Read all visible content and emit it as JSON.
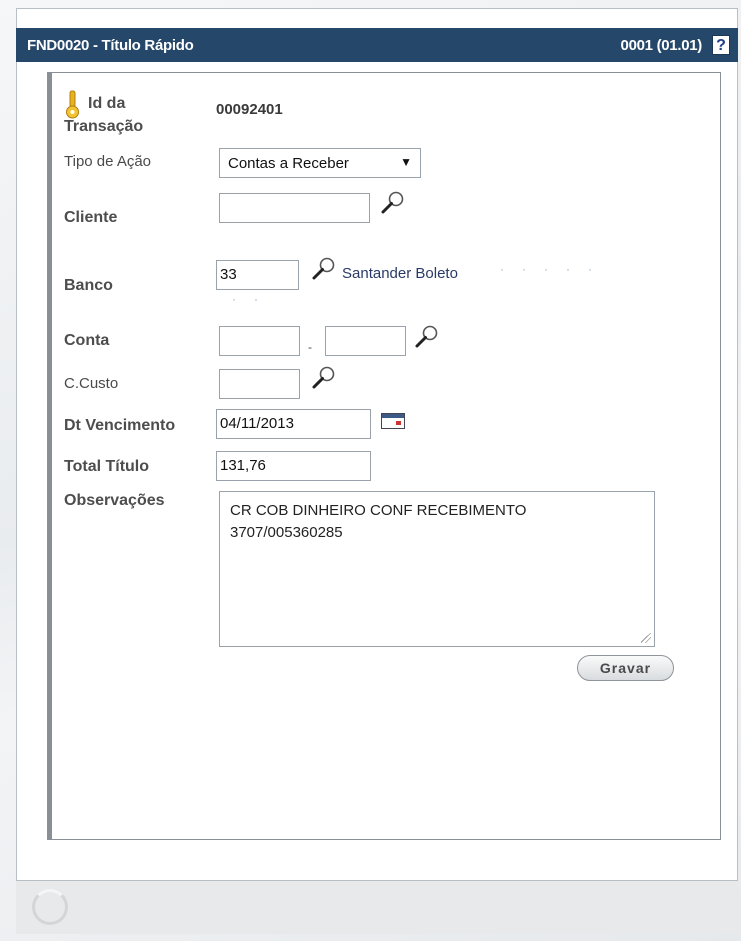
{
  "window": {
    "title": "FND0020 - Título Rápido",
    "version": "0001 (01.01)",
    "help_label": "?"
  },
  "form": {
    "id_label_line1": "Id da",
    "id_label_line2": "Transação",
    "id_value": "00092401",
    "tipo_label": "Tipo de Ação",
    "tipo_value": "Contas a Receber",
    "cliente_label": "Cliente",
    "cliente_value": "",
    "banco_label": "Banco",
    "banco_value": "33",
    "banco_name": "Santander Boleto",
    "conta_label": "Conta",
    "conta_sep": "-",
    "ccusto_label": "C.Custo",
    "vencimento_label": "Dt Vencimento",
    "vencimento_value": "04/11/2013",
    "total_label": "Total Título",
    "total_value": "131,76",
    "obs_label": "Observações",
    "obs_value": "CR COB DINHEIRO CONF RECEBIMENTO\n3707/005360285",
    "save_label": "Gravar"
  }
}
